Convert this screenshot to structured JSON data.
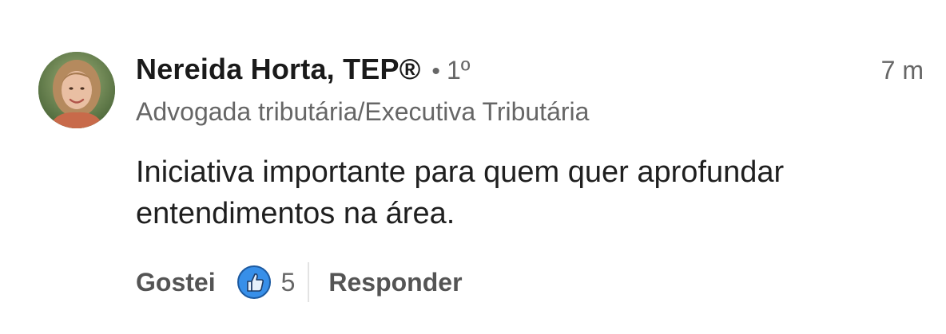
{
  "comment": {
    "author": {
      "name": "Nereida Horta, TEP®",
      "separator": "•",
      "connection_degree": "1º",
      "headline": "Advogada tributária/Executiva Tributária",
      "avatar_icon": "profile-photo"
    },
    "timestamp": "7 m",
    "text": "Iniciativa importante para quem quer aprofundar entendimentos na área.",
    "actions": {
      "like_label": "Gostei",
      "reaction_icon": "thumbs-up-icon",
      "reaction_count": "5",
      "reply_label": "Responder"
    }
  },
  "colors": {
    "primary_text": "#1a1a1a",
    "secondary_text": "#666666",
    "action_text": "#545454",
    "reaction_blue": "#378fe9",
    "divider": "#e3e3e3"
  }
}
